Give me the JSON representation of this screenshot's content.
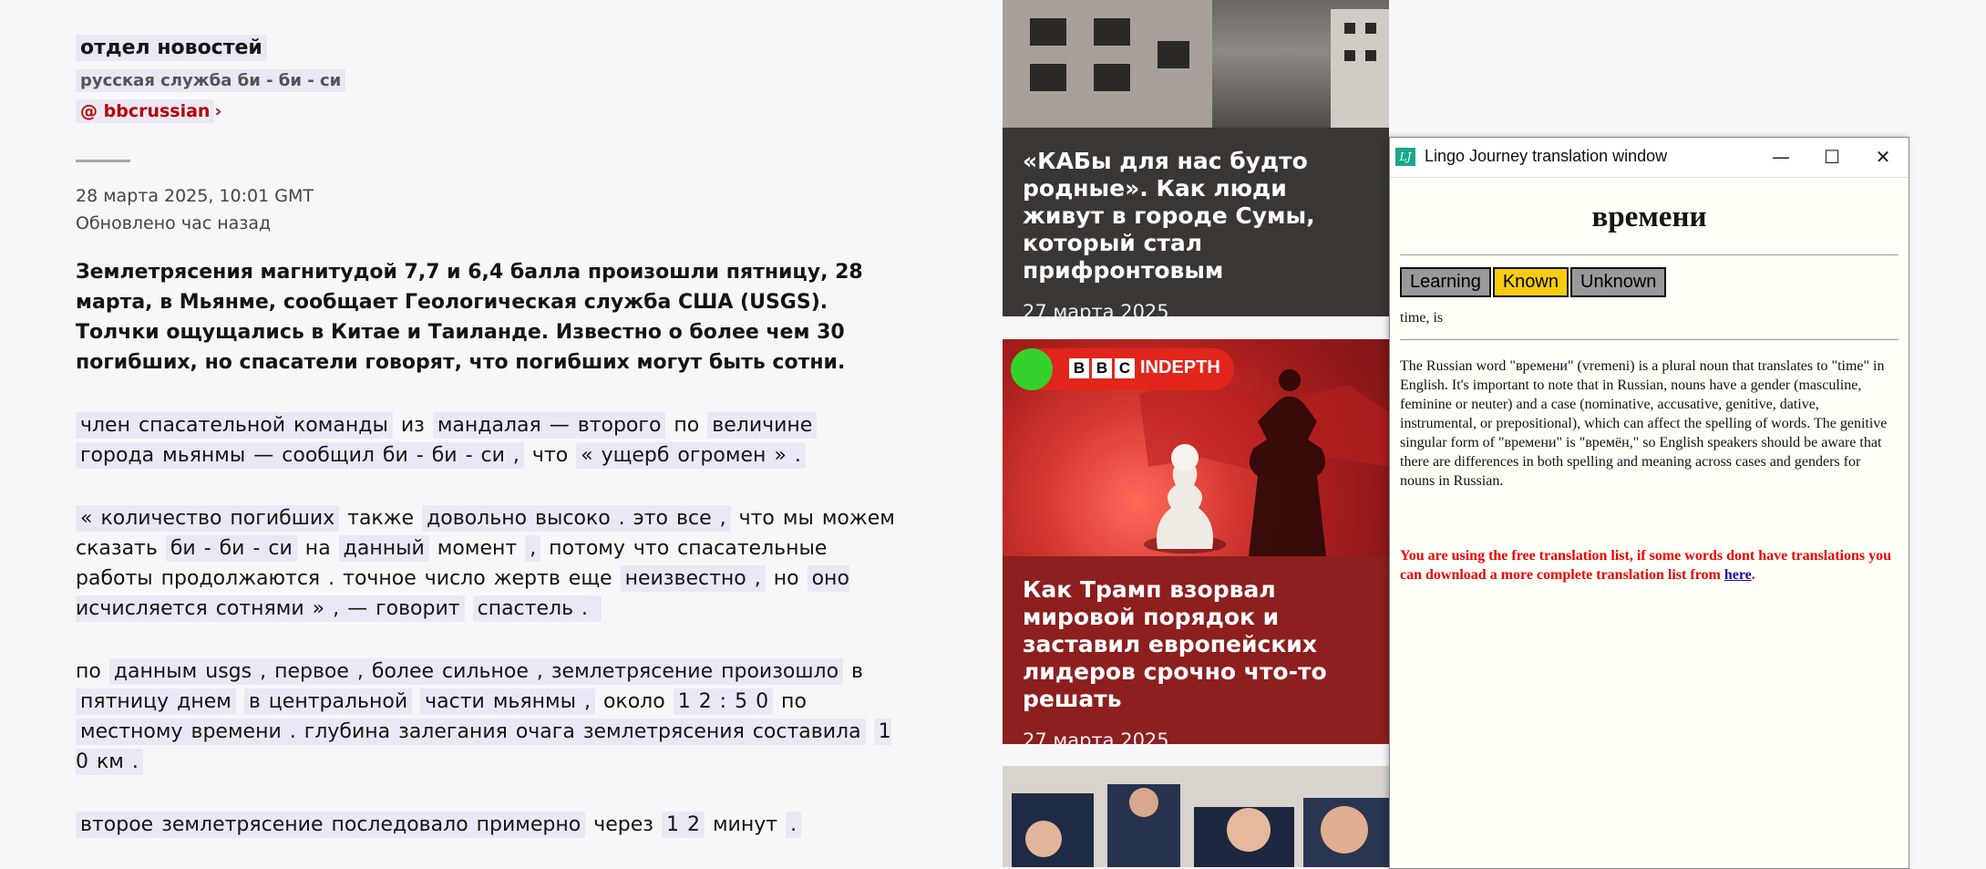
{
  "byline": {
    "name": "отдел новостей",
    "role": "русская служба би - би - си",
    "handle": "@ bbcrussian",
    "handle_chevron": "›"
  },
  "meta": {
    "date": "28 марта 2025, 10:01 GMT",
    "updated": "Обновлено час назад"
  },
  "lead": "Землетрясения магнитудой 7,7 и 6,4 балла произошли пятницу, 28 марта, в Мьянме, сообщает Геологическая служба США (USGS). Толчки ощущались в Китае и Таиланде. Известно о более чем 30 погибших, но спасатели говорят, что погибших могут быть сотни.",
  "paragraphs": [
    [
      "член спасательной команды",
      " из ",
      "мандалая — второго",
      " по ",
      "величине",
      " ",
      "города мьянмы — сообщил би - би - си ,",
      " что ",
      "« ущерб огромен » ."
    ],
    [
      "« количество погибших",
      " также ",
      "довольно высоко . это все ,",
      " что мы можем сказать ",
      "би - би - си",
      " на ",
      "данный",
      " момент ",
      ",",
      " потому что спасательные работы продолжаются . точное число жертв еще ",
      "неизвестно ,",
      " но ",
      "оно исчисляется сотнями » , — говорит",
      " ",
      "спастель ."
    ],
    [
      "по",
      " ",
      "данным usgs , первое , более сильное , землетрясение произошло",
      " в ",
      "пятницу днем",
      " ",
      "в центральной",
      " ",
      "части мьянмы ,",
      " около ",
      "1 2 : 5 0",
      " по ",
      "местному времени . глубина залегания очага землетрясения составила",
      " ",
      "1 0 км ."
    ],
    [
      "второе землетрясение последовало примерно",
      " через ",
      "1 2",
      " минут ",
      "."
    ]
  ],
  "cards": [
    {
      "title": "«КАБы для нас будто родные». Как люди живут в городе Сумы, который стал прифронтовым",
      "date": "27 марта 2025"
    },
    {
      "title": "Как Трамп взорвал мировой порядок и заставил европейских лидеров срочно что-то решать",
      "date": "27 марта 2025",
      "badge": "INDEPTH",
      "badge_letters": [
        "B",
        "B",
        "C"
      ]
    }
  ],
  "translation_window": {
    "title": "Lingo Journey translation window",
    "logo": "LJ",
    "word": "времени",
    "buttons": [
      "Learning",
      "Known",
      "Unknown"
    ],
    "selected_button": "Known",
    "translation": "time, is",
    "description": "The Russian word \"времени\" (vremeni) is a plural noun that translates to \"time\" in English. It's important to note that in Russian, nouns have a gender (masculine, feminine or neuter) and a case (nominative, accusative, genitive, dative, instrumental, or prepositional), which can affect the spelling of words. The genitive singular form of \"времени\" is \"времён,\" so English speakers should be aware that there are differences in both spelling and meaning across cases and genders for nouns in Russian.",
    "warning": "You are using the free translation list, if some words dont have translations you can download a more complete translation list from ",
    "warning_link": "here",
    "warning_end": ".",
    "controls": {
      "minimize": "—",
      "maximize": "☐",
      "close": "✕"
    },
    "colors": {
      "known": "#f6cc13",
      "warning": "#ee0000",
      "logo": "#1aa88c"
    }
  },
  "colors": {
    "highlight": "#ebe8f5",
    "brand_red": "#b80000"
  }
}
